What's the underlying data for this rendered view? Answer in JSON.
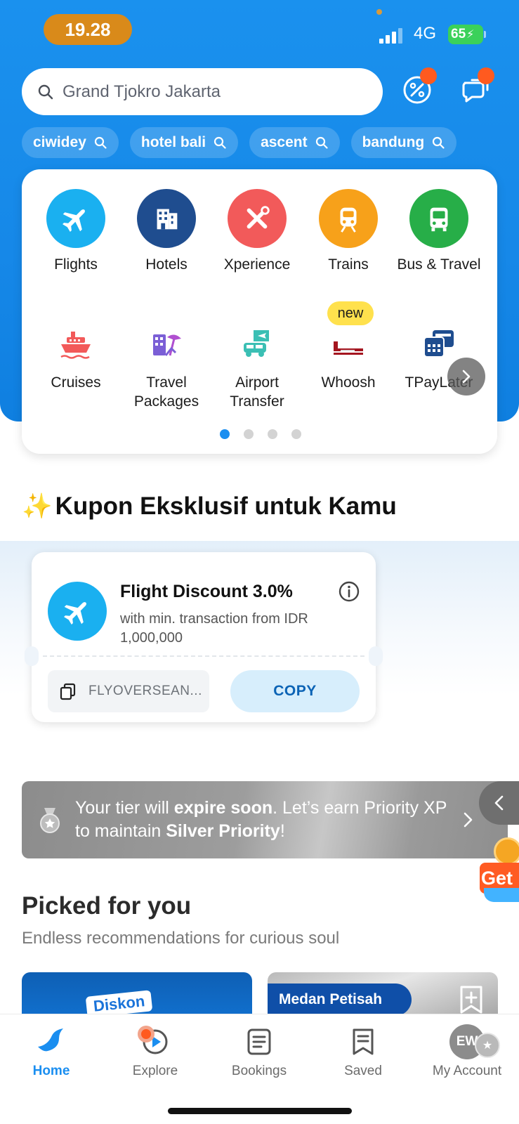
{
  "status_bar": {
    "time": "19.28",
    "network": "4G",
    "battery": "65"
  },
  "search": {
    "placeholder": "Grand Tjokro Jakarta"
  },
  "chips": [
    "ciwidey",
    "hotel bali",
    "ascent",
    "bandung"
  ],
  "products_row1": [
    {
      "label": "Flights",
      "icon": "airplane-icon",
      "color": "#1ab0f0"
    },
    {
      "label": "Hotels",
      "icon": "hotel-building-icon",
      "color": "#1f4d8f"
    },
    {
      "label": "Xperience",
      "icon": "xperience-icon",
      "color": "#f25a5a"
    },
    {
      "label": "Trains",
      "icon": "train-icon",
      "color": "#f7a11a"
    },
    {
      "label": "Bus & Travel",
      "icon": "bus-icon",
      "color": "#27ae48"
    }
  ],
  "products_row2": [
    {
      "label": "Cruises",
      "icon": "cruise-ship-icon"
    },
    {
      "label": "Travel Packages",
      "icon": "travel-packages-icon"
    },
    {
      "label": "Airport Transfer",
      "icon": "airport-transfer-icon"
    },
    {
      "label": "Whoosh",
      "icon": "whoosh-train-icon"
    },
    {
      "label": "TPayLater",
      "icon": "tpaylater-icon"
    }
  ],
  "new_badge": "new",
  "coupon_section": {
    "title": "Kupon Eksklusif untuk Kamu",
    "coupon": {
      "title": "Flight Discount 3.0%",
      "description": "with min. transaction from IDR 1,000,000",
      "code": "FLYOVERSEAN...",
      "copy_label": "COPY"
    }
  },
  "tier_banner": {
    "part1": "Your tier will ",
    "bold1": "expire soon",
    "part2": ". Let’s earn Priority XP to maintain ",
    "bold2": "Silver Priority",
    "part3": "!"
  },
  "promo_float": {
    "label": "Get"
  },
  "picked": {
    "title": "Picked for you",
    "subtitle": "Endless recommendations for curious soul",
    "card1_promo": "Diskon",
    "card2_location": "Medan Petisah"
  },
  "bottom_nav": [
    {
      "label": "Home",
      "active": true
    },
    {
      "label": "Explore"
    },
    {
      "label": "Bookings"
    },
    {
      "label": "Saved"
    },
    {
      "label": "My Account"
    }
  ],
  "account_initials": "EW",
  "colors": {
    "brand_blue": "#1a8ef0",
    "accent_orange": "#ff5a1f"
  }
}
